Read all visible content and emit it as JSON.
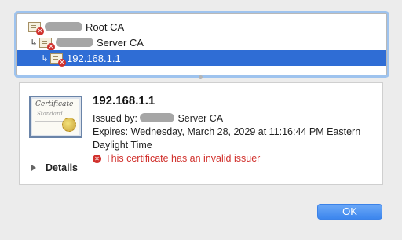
{
  "chain": [
    {
      "label": "Root CA",
      "redacted": true
    },
    {
      "label": "Server CA",
      "redacted": true
    },
    {
      "label": "192.168.1.1",
      "redacted": false
    }
  ],
  "details": {
    "name": "192.168.1.1",
    "issued_by_prefix": "Issued by:",
    "issued_by_suffix": "Server CA",
    "expires": "Expires: Wednesday, March 28, 2029 at 11:16:44 PM Eastern Daylight Time",
    "error": "This certificate has an invalid issuer",
    "details_label": "Details",
    "cert_image_text1": "Certificate",
    "cert_image_text2": "Standard"
  },
  "buttons": {
    "ok": "OK"
  },
  "colors": {
    "selection": "#2f6dd5",
    "error": "#d1302c",
    "ok_button": "#3c86ee"
  },
  "icons": {
    "cert": "certificate-icon",
    "error": "error-x-icon",
    "arrow": "child-arrow-icon",
    "disclosure": "disclosure-triangle-icon"
  }
}
